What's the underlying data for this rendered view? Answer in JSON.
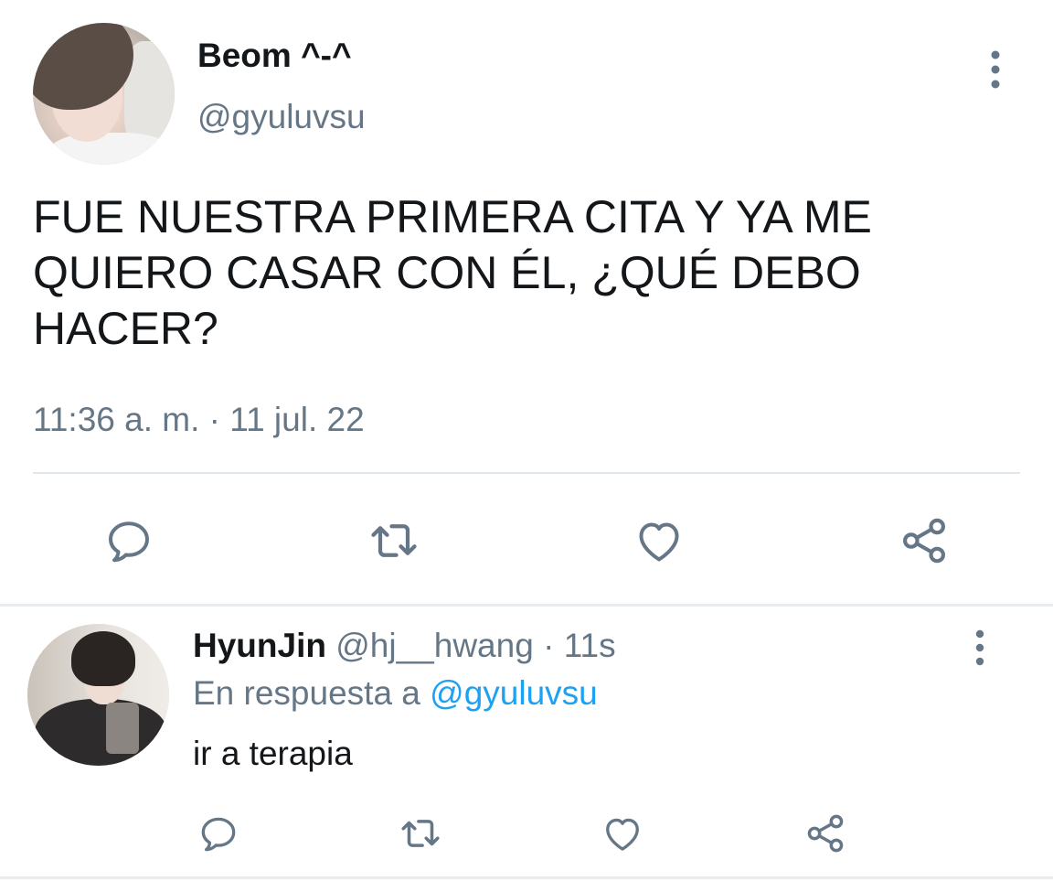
{
  "main_tweet": {
    "author": {
      "display_name": "Beom ^-^",
      "handle": "@gyuluvsu",
      "avatar_icon": "profile-photo"
    },
    "text": "FUE NUESTRA PRIMERA CITA Y YA ME\nQUIERO CASAR CON ÉL, ¿QUÉ DEBO\nHACER?",
    "timestamp": "11:36 a. m. · 11 jul. 22",
    "actions": [
      {
        "name": "reply",
        "icon": "reply-icon"
      },
      {
        "name": "retweet",
        "icon": "retweet-icon"
      },
      {
        "name": "like",
        "icon": "heart-icon"
      },
      {
        "name": "share",
        "icon": "share-icon"
      }
    ],
    "more_icon": "more-vertical-icon"
  },
  "reply_tweet": {
    "author": {
      "display_name": "HyunJin",
      "handle": "@hj__hwang",
      "avatar_icon": "profile-photo"
    },
    "separator": " · ",
    "time_ago": "11s",
    "reply_prefix": "En respuesta a ",
    "reply_mention": "@gyuluvsu",
    "text": "ir a terapia",
    "actions": [
      {
        "name": "reply",
        "icon": "reply-icon"
      },
      {
        "name": "retweet",
        "icon": "retweet-icon"
      },
      {
        "name": "like",
        "icon": "heart-icon"
      },
      {
        "name": "share",
        "icon": "share-icon"
      }
    ],
    "more_icon": "more-vertical-icon"
  },
  "colors": {
    "text_primary": "#14171a",
    "text_secondary": "#657786",
    "link": "#1da1f2",
    "divider": "#e6ecf0",
    "icon": "#657786"
  }
}
